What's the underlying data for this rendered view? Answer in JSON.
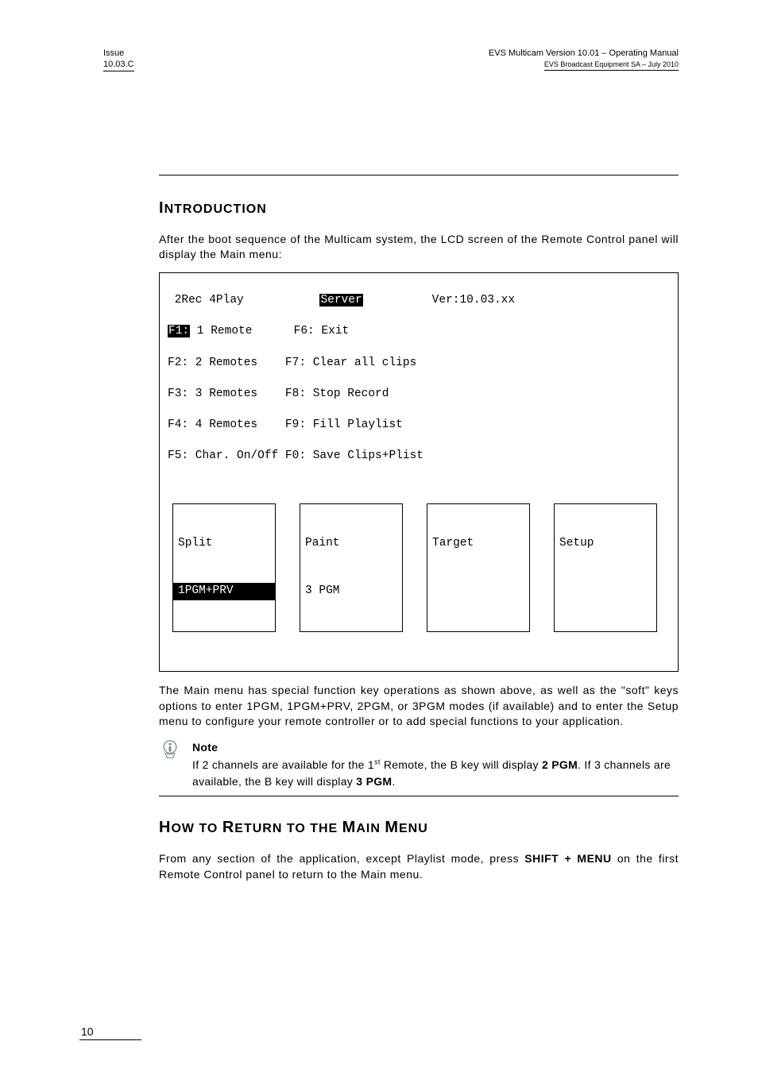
{
  "header": {
    "issue_label": "Issue",
    "issue_value": "10.03.C",
    "doc_title": "EVS Multicam Version 10.01 – Operating Manual",
    "doc_sub": "EVS Broadcast Equipment SA – July 2010"
  },
  "section1": {
    "title_first": "I",
    "title_rest": "NTRODUCTION",
    "intro_para": "After the boot sequence of the Multicam system, the LCD screen of the Remote Control panel will display the Main menu:"
  },
  "lcd": {
    "line1_left": " 2Rec 4Play",
    "line1_center": "Server",
    "line1_right": "Ver:10.03.xx",
    "f1_prefix": "F1:",
    "f1_rest": " 1 Remote      F6: Exit",
    "line3": "F2: 2 Remotes    F7: Clear all clips",
    "line4": "F3: 3 Remotes    F8: Stop Record",
    "line5": "F4: 4 Remotes    F9: Fill Playlist",
    "line6": "F5: Char. On/Off F0: Save Clips+Plist",
    "softkeys": [
      {
        "top": "Split",
        "bottom": "1PGM+PRV",
        "bottom_hl": true
      },
      {
        "top": "Paint",
        "bottom": "3 PGM",
        "bottom_hl": false
      },
      {
        "top": "Target",
        "bottom": "",
        "bottom_hl": false
      },
      {
        "top": "Setup",
        "bottom": "",
        "bottom_hl": false
      }
    ]
  },
  "after_lcd_para": "The Main menu has special function key operations as shown above, as well as the \"soft\" keys options to enter 1PGM, 1PGM+PRV, 2PGM, or 3PGM modes (if available) and to enter the Setup menu to configure your remote controller or to add special functions to your application.",
  "note": {
    "title": "Note",
    "line1_a": "If 2 channels are available for the 1",
    "line1_sup": "st",
    "line1_b": " Remote, the B key will display ",
    "line1_bold": "2 PGM",
    "line1_c": ". If 3 channels are available, the B key will display ",
    "line1_bold2": "3 PGM",
    "line1_d": "."
  },
  "section2": {
    "title_first": "H",
    "title_rest_a": "OW TO ",
    "title_mid": "R",
    "title_rest_b": "ETURN TO THE ",
    "title_mid2": "M",
    "title_rest_c": "AIN ",
    "title_mid3": "M",
    "title_rest_d": "ENU",
    "para_a": "From any section of the application, except Playlist mode, press ",
    "para_bold": "SHIFT + MENU",
    "para_b": " on the first Remote Control panel to return to the Main menu."
  },
  "footer": {
    "page": "10"
  }
}
